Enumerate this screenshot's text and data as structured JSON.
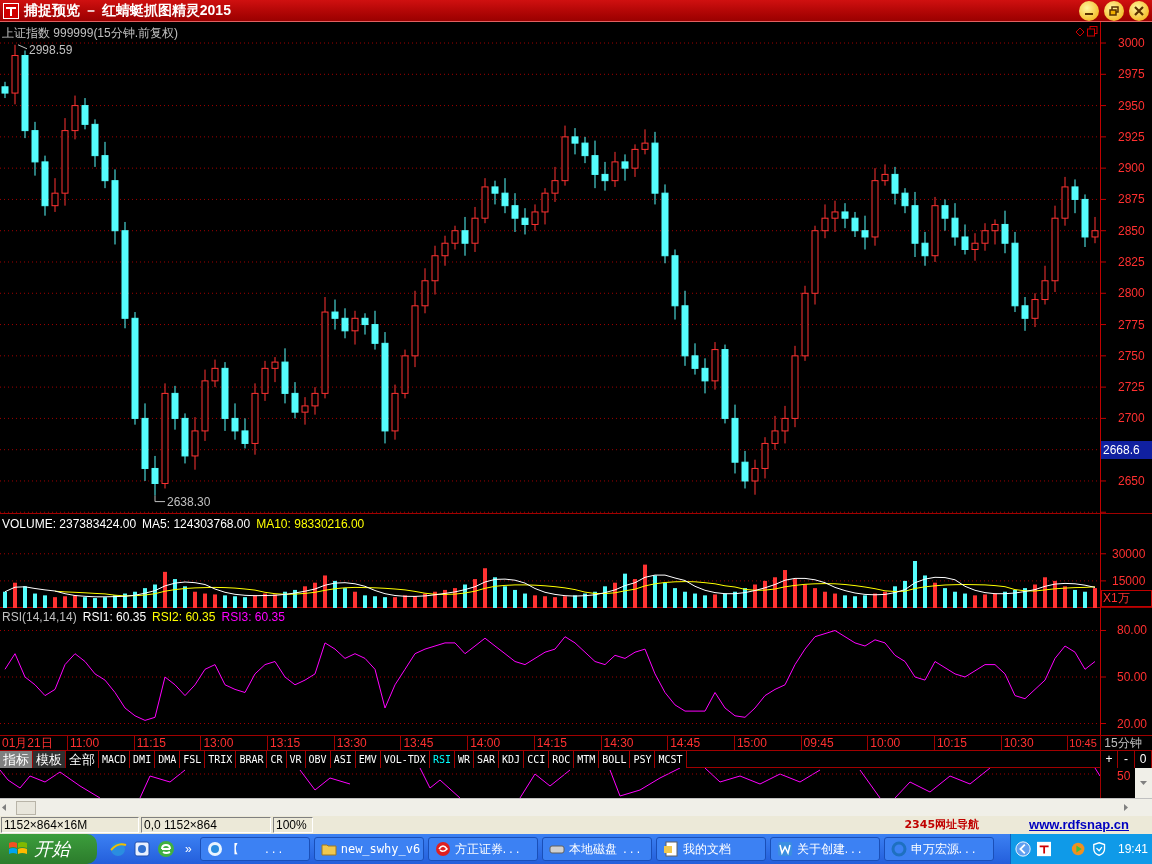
{
  "window": {
    "title": "捕捉预览 － 红蜻蜓抓图精灵2015"
  },
  "price_pane": {
    "title": "上证指数 999999(15分钟.前复权)",
    "high_mark": "2998.59",
    "low_mark": "2638.30",
    "current_price": "2668.6",
    "chart_data": {
      "type": "candlestick",
      "ylim": [
        2623.6,
        3016.8
      ],
      "grid": true,
      "yticks": [
        2650,
        2700,
        2725,
        2750,
        2775,
        2800,
        2825,
        2850,
        2875,
        2900,
        2925,
        2950,
        2975,
        3000
      ],
      "ohlc": [
        [
          2965,
          2969,
          2956,
          2960
        ],
        [
          2960,
          2998.59,
          2951,
          2990
        ],
        [
          2990,
          2994,
          2924,
          2930
        ],
        [
          2930,
          2937,
          2894,
          2905
        ],
        [
          2905,
          2910,
          2862,
          2870
        ],
        [
          2870,
          2892,
          2865,
          2880
        ],
        [
          2880,
          2940,
          2870,
          2930
        ],
        [
          2930,
          2958,
          2923,
          2950
        ],
        [
          2950,
          2956,
          2931,
          2935
        ],
        [
          2935,
          2939,
          2901,
          2910
        ],
        [
          2910,
          2921,
          2884,
          2890
        ],
        [
          2890,
          2899,
          2839,
          2850
        ],
        [
          2850,
          2857,
          2772,
          2780
        ],
        [
          2780,
          2785,
          2695,
          2700
        ],
        [
          2700,
          2712,
          2650,
          2660
        ],
        [
          2660,
          2670,
          2638.3,
          2648
        ],
        [
          2648,
          2728,
          2644,
          2720
        ],
        [
          2720,
          2726,
          2691,
          2700
        ],
        [
          2700,
          2704,
          2664,
          2670
        ],
        [
          2670,
          2701,
          2659,
          2690
        ],
        [
          2690,
          2739,
          2682,
          2730
        ],
        [
          2730,
          2747,
          2725,
          2740
        ],
        [
          2740,
          2745,
          2690,
          2700
        ],
        [
          2700,
          2712,
          2683,
          2690
        ],
        [
          2690,
          2700,
          2676,
          2680
        ],
        [
          2680,
          2728,
          2671,
          2720
        ],
        [
          2720,
          2746,
          2714,
          2740
        ],
        [
          2740,
          2749,
          2729,
          2745
        ],
        [
          2745,
          2756,
          2712,
          2720
        ],
        [
          2720,
          2729,
          2700,
          2705
        ],
        [
          2705,
          2717,
          2695,
          2710
        ],
        [
          2710,
          2725,
          2703,
          2720
        ],
        [
          2720,
          2797,
          2716,
          2785
        ],
        [
          2785,
          2795,
          2771,
          2780
        ],
        [
          2780,
          2788,
          2764,
          2770
        ],
        [
          2770,
          2786,
          2759,
          2780
        ],
        [
          2780,
          2784,
          2767,
          2775
        ],
        [
          2775,
          2786,
          2755,
          2760
        ],
        [
          2760,
          2769,
          2680,
          2690
        ],
        [
          2690,
          2727,
          2683,
          2720
        ],
        [
          2720,
          2755,
          2716,
          2750
        ],
        [
          2750,
          2802,
          2741,
          2790
        ],
        [
          2790,
          2820,
          2784,
          2810
        ],
        [
          2810,
          2838,
          2799,
          2830
        ],
        [
          2830,
          2846,
          2822,
          2840
        ],
        [
          2840,
          2854,
          2835,
          2850
        ],
        [
          2850,
          2861,
          2830,
          2840
        ],
        [
          2840,
          2869,
          2833,
          2860
        ],
        [
          2860,
          2892,
          2856,
          2885
        ],
        [
          2885,
          2890,
          2871,
          2880
        ],
        [
          2880,
          2892,
          2864,
          2870
        ],
        [
          2870,
          2880,
          2849,
          2860
        ],
        [
          2860,
          2868,
          2847,
          2855
        ],
        [
          2855,
          2871,
          2850,
          2865
        ],
        [
          2865,
          2884,
          2855,
          2880
        ],
        [
          2880,
          2901,
          2873,
          2890
        ],
        [
          2890,
          2934,
          2886,
          2925
        ],
        [
          2925,
          2932,
          2911,
          2920
        ],
        [
          2920,
          2925,
          2904,
          2910
        ],
        [
          2910,
          2922,
          2884,
          2895
        ],
        [
          2895,
          2905,
          2882,
          2890
        ],
        [
          2890,
          2913,
          2885,
          2905
        ],
        [
          2905,
          2911,
          2890,
          2900
        ],
        [
          2900,
          2919,
          2893,
          2915
        ],
        [
          2915,
          2931,
          2911,
          2920
        ],
        [
          2920,
          2929,
          2871,
          2880
        ],
        [
          2880,
          2887,
          2824,
          2830
        ],
        [
          2830,
          2835,
          2779,
          2790
        ],
        [
          2790,
          2802,
          2742,
          2750
        ],
        [
          2750,
          2760,
          2735,
          2740
        ],
        [
          2740,
          2748,
          2720,
          2730
        ],
        [
          2730,
          2761,
          2723,
          2755
        ],
        [
          2755,
          2759,
          2696,
          2700
        ],
        [
          2700,
          2711,
          2656,
          2665
        ],
        [
          2665,
          2674,
          2644,
          2650
        ],
        [
          2650,
          2667,
          2639,
          2660
        ],
        [
          2660,
          2685,
          2652,
          2680
        ],
        [
          2680,
          2702,
          2675,
          2690
        ],
        [
          2690,
          2710,
          2680,
          2700
        ],
        [
          2700,
          2758,
          2693,
          2750
        ],
        [
          2750,
          2806,
          2746,
          2800
        ],
        [
          2800,
          2854,
          2791,
          2850
        ],
        [
          2850,
          2871,
          2844,
          2860
        ],
        [
          2860,
          2874,
          2849,
          2865
        ],
        [
          2865,
          2872,
          2852,
          2860
        ],
        [
          2860,
          2865,
          2845,
          2850
        ],
        [
          2850,
          2862,
          2835,
          2845
        ],
        [
          2845,
          2900,
          2838,
          2890
        ],
        [
          2890,
          2903,
          2886,
          2895
        ],
        [
          2895,
          2901,
          2871,
          2880
        ],
        [
          2880,
          2884,
          2864,
          2870
        ],
        [
          2870,
          2881,
          2829,
          2840
        ],
        [
          2840,
          2849,
          2822,
          2830
        ],
        [
          2830,
          2877,
          2825,
          2870
        ],
        [
          2870,
          2875,
          2850,
          2860
        ],
        [
          2860,
          2872,
          2838,
          2845
        ],
        [
          2845,
          2855,
          2831,
          2835
        ],
        [
          2835,
          2848,
          2826,
          2840
        ],
        [
          2840,
          2856,
          2834,
          2850
        ],
        [
          2850,
          2859,
          2839,
          2855
        ],
        [
          2855,
          2866,
          2832,
          2840
        ],
        [
          2840,
          2849,
          2785,
          2790
        ],
        [
          2790,
          2797,
          2770,
          2780
        ],
        [
          2780,
          2800,
          2773,
          2795
        ],
        [
          2795,
          2822,
          2791,
          2810
        ],
        [
          2810,
          2870,
          2801,
          2860
        ],
        [
          2860,
          2893,
          2854,
          2885
        ],
        [
          2885,
          2891,
          2864,
          2875
        ],
        [
          2875,
          2879,
          2837,
          2845
        ],
        [
          2845,
          2861,
          2840,
          2850
        ]
      ]
    }
  },
  "volume_pane": {
    "volume": "VOLUME: 237383424.00",
    "ma5": "MA5: 124303768.00",
    "ma10": "MA10: 98330216.00",
    "unit": "X1万",
    "chart_data": {
      "type": "bar",
      "ylim": [
        0,
        52000
      ],
      "yticks": [
        15000,
        30000
      ],
      "grid": true,
      "colors": [
        "#54fcfc",
        "#ff3232",
        "#54fcfc",
        "#54fcfc",
        "#54fcfc",
        "#ff3232",
        "#ff3232",
        "#ff3232",
        "#54fcfc",
        "#54fcfc",
        "#54fcfc",
        "#54fcfc",
        "#54fcfc",
        "#54fcfc",
        "#54fcfc",
        "#54fcfc",
        "#ff3232",
        "#54fcfc",
        "#54fcfc",
        "#ff3232",
        "#ff3232",
        "#ff3232",
        "#54fcfc",
        "#54fcfc",
        "#54fcfc",
        "#ff3232",
        "#ff3232",
        "#ff3232",
        "#54fcfc",
        "#54fcfc",
        "#ff3232",
        "#ff3232",
        "#ff3232",
        "#54fcfc",
        "#54fcfc",
        "#ff3232",
        "#54fcfc",
        "#54fcfc",
        "#54fcfc",
        "#ff3232",
        "#ff3232",
        "#ff3232",
        "#ff3232",
        "#ff3232",
        "#ff3232",
        "#ff3232",
        "#54fcfc",
        "#ff3232",
        "#ff3232",
        "#54fcfc",
        "#54fcfc",
        "#54fcfc",
        "#54fcfc",
        "#ff3232",
        "#ff3232",
        "#ff3232",
        "#ff3232",
        "#54fcfc",
        "#54fcfc",
        "#54fcfc",
        "#54fcfc",
        "#ff3232",
        "#54fcfc",
        "#ff3232",
        "#ff3232",
        "#54fcfc",
        "#54fcfc",
        "#54fcfc",
        "#54fcfc",
        "#54fcfc",
        "#54fcfc",
        "#ff3232",
        "#54fcfc",
        "#54fcfc",
        "#54fcfc",
        "#ff3232",
        "#ff3232",
        "#ff3232",
        "#ff3232",
        "#ff3232",
        "#ff3232",
        "#ff3232",
        "#ff3232",
        "#ff3232",
        "#54fcfc",
        "#54fcfc",
        "#54fcfc",
        "#ff3232",
        "#ff3232",
        "#54fcfc",
        "#54fcfc",
        "#54fcfc",
        "#54fcfc",
        "#ff3232",
        "#54fcfc",
        "#54fcfc",
        "#54fcfc",
        "#ff3232",
        "#ff3232",
        "#ff3232",
        "#54fcfc",
        "#54fcfc",
        "#54fcfc",
        "#ff3232",
        "#ff3232",
        "#ff3232",
        "#ff3232",
        "#54fcfc",
        "#54fcfc",
        "#ff3232"
      ],
      "values": [
        9000,
        14000,
        12000,
        8000,
        7000,
        6000,
        6500,
        7000,
        6000,
        5500,
        6000,
        7000,
        8000,
        9000,
        11000,
        13000,
        20000,
        16000,
        12000,
        9000,
        8000,
        7500,
        7000,
        6500,
        6000,
        7000,
        8000,
        7500,
        9000,
        10000,
        12000,
        14000,
        18000,
        15000,
        11000,
        9000,
        7000,
        6500,
        6000,
        6000,
        7000,
        6500,
        8000,
        9000,
        10000,
        11000,
        13000,
        16000,
        22000,
        17000,
        12000,
        10000,
        8000,
        7000,
        6500,
        6000,
        6500,
        7000,
        8000,
        9000,
        12000,
        14000,
        19000,
        16000,
        24000,
        18000,
        14000,
        11000,
        9000,
        8000,
        7000,
        7500,
        8000,
        9000,
        11000,
        13000,
        15000,
        17000,
        21000,
        16000,
        13000,
        11000,
        9000,
        8000,
        7000,
        6500,
        7000,
        8000,
        9000,
        12000,
        15000,
        26000,
        18000,
        14000,
        11000,
        9000,
        8000,
        7000,
        7500,
        8000,
        9000,
        10000,
        11000,
        13000,
        17000,
        15000,
        12000,
        10000,
        9000,
        11000
      ],
      "series": [
        {
          "type": "line",
          "color": "#ffffff",
          "values": [
            9000,
            11500,
            11700,
            10800,
            10000,
            9400,
            7900,
            6900,
            6500,
            6200,
            6200,
            6300,
            6500,
            7100,
            8200,
            9600,
            12200,
            13800,
            14400,
            14000,
            13000,
            10500,
            8700,
            7600,
            7000,
            6800,
            6900,
            7000,
            7500,
            8300,
            9300,
            10500,
            12600,
            13800,
            14000,
            13400,
            12000,
            9700,
            7900,
            6900,
            6500,
            6400,
            6700,
            7300,
            8100,
            8900,
            10200,
            11800,
            14400,
            15800,
            16000,
            15400,
            13800,
            10800,
            8700,
            7500,
            6800,
            6600,
            6800,
            7300,
            8500,
            10000,
            12400,
            14000,
            17000,
            18200,
            18200,
            16600,
            15200,
            12000,
            9800,
            8500,
            7900,
            7900,
            8500,
            9700,
            11200,
            13000,
            15400,
            16400,
            16400,
            15600,
            14000,
            11400,
            9600,
            8300,
            7500,
            7300,
            7500,
            8500,
            10200,
            14000,
            16000,
            17000,
            16800,
            15600,
            12000,
            9800,
            8500,
            7900,
            7900,
            8300,
            9100,
            10200,
            12000,
            13200,
            13600,
            13400,
            12600,
            11400
          ]
        },
        {
          "type": "line",
          "color": "#ffff00",
          "values": [
            null,
            null,
            null,
            null,
            null,
            9300,
            8900,
            8700,
            8400,
            8100,
            7800,
            7100,
            6700,
            6800,
            7200,
            7900,
            9300,
            10200,
            10800,
            11100,
            11300,
            11400,
            11300,
            11000,
            10500,
            9900,
            8700,
            7900,
            7600,
            7700,
            8100,
            8700,
            9800,
            10700,
            11200,
            11400,
            11300,
            11200,
            10900,
            10500,
            10000,
            9200,
            8200,
            7600,
            7500,
            7700,
            8300,
            9300,
            10900,
            12000,
            12500,
            12800,
            12800,
            12600,
            12300,
            11800,
            11100,
            10200,
            8800,
            8000,
            8000,
            8400,
            9500,
            10400,
            12200,
            13400,
            14100,
            14500,
            14600,
            14500,
            14000,
            13400,
            12300,
            11600,
            10300,
            9800,
            9900,
            10500,
            11700,
            12500,
            13100,
            13400,
            13500,
            13400,
            13000,
            12400,
            11600,
            10700,
            9500,
            9100,
            9300,
            10800,
            11700,
            12300,
            12700,
            12900,
            13000,
            12900,
            12800,
            12400,
            11800,
            10200,
            9500,
            9400,
            10000,
            10600,
            11000,
            11300,
            11400,
            11700
          ]
        }
      ]
    }
  },
  "rsi_pane": {
    "label": "RSI(14,14,14)",
    "rsi1": "RSI1: 60.35",
    "rsi2": "RSI2: 60.35",
    "rsi3": "RSI3: 60.35",
    "chart_data": {
      "type": "line",
      "ylim": [
        12.6,
        94.5
      ],
      "grid": true,
      "yticks": [
        {
          "value": 20,
          "label": "20.00"
        },
        {
          "value": 50,
          "label": "50.00"
        },
        {
          "value": 80,
          "label": "80.00"
        }
      ],
      "series": [
        {
          "color": "#ff00ff",
          "values": [
            55,
            65,
            50,
            45,
            38,
            42,
            58,
            65,
            60,
            52,
            48,
            40,
            30,
            25,
            22,
            24,
            50,
            45,
            38,
            45,
            55,
            58,
            45,
            42,
            40,
            52,
            58,
            60,
            50,
            45,
            48,
            52,
            72,
            68,
            62,
            65,
            62,
            55,
            30,
            45,
            55,
            65,
            68,
            70,
            72,
            72,
            65,
            70,
            75,
            70,
            65,
            60,
            58,
            62,
            66,
            68,
            76,
            72,
            66,
            60,
            58,
            64,
            62,
            66,
            68,
            52,
            40,
            32,
            28,
            28,
            28,
            40,
            30,
            25,
            24,
            30,
            38,
            42,
            45,
            58,
            68,
            76,
            78,
            80,
            76,
            72,
            70,
            74,
            72,
            64,
            60,
            50,
            48,
            60,
            56,
            52,
            50,
            54,
            58,
            58,
            52,
            38,
            36,
            42,
            48,
            62,
            70,
            66,
            55,
            60
          ]
        }
      ]
    }
  },
  "time_axis": {
    "labels": [
      "01月21日",
      "11:00",
      "11:15",
      "13:00",
      "13:15",
      "13:30",
      "13:45",
      "14:00",
      "14:15",
      "14:30",
      "14:45",
      "15:00",
      "09:45",
      "10:00",
      "10:15",
      "10:30",
      "10:45"
    ],
    "period": "15分钟"
  },
  "tabs": [
    {
      "label": "指标",
      "kind": "mode",
      "selected": true
    },
    {
      "label": "模板",
      "kind": "mode",
      "selected": false
    },
    {
      "label": "全部",
      "kind": "mode",
      "selected": false
    },
    {
      "label": "MACD",
      "kind": "indicator",
      "selected": false
    },
    {
      "label": "DMI",
      "kind": "indicator",
      "selected": false
    },
    {
      "label": "DMA",
      "kind": "indicator",
      "selected": false
    },
    {
      "label": "FSL",
      "kind": "indicator",
      "selected": false
    },
    {
      "label": "TRIX",
      "kind": "indicator",
      "selected": false
    },
    {
      "label": "BRAR",
      "kind": "indicator",
      "selected": false
    },
    {
      "label": "CR",
      "kind": "indicator",
      "selected": false
    },
    {
      "label": "VR",
      "kind": "indicator",
      "selected": false
    },
    {
      "label": "OBV",
      "kind": "indicator",
      "selected": false
    },
    {
      "label": "ASI",
      "kind": "indicator",
      "selected": false
    },
    {
      "label": "EMV",
      "kind": "indicator",
      "selected": false
    },
    {
      "label": "VOL-TDX",
      "kind": "indicator",
      "selected": false
    },
    {
      "label": "RSI",
      "kind": "indicator",
      "selected": true
    },
    {
      "label": "WR",
      "kind": "indicator",
      "selected": false
    },
    {
      "label": "SAR",
      "kind": "indicator",
      "selected": false
    },
    {
      "label": "KDJ",
      "kind": "indicator",
      "selected": false
    },
    {
      "label": "CCI",
      "kind": "indicator",
      "selected": false
    },
    {
      "label": "ROC",
      "kind": "indicator",
      "selected": false
    },
    {
      "label": "MTM",
      "kind": "indicator",
      "selected": false
    },
    {
      "label": "BOLL",
      "kind": "indicator",
      "selected": false
    },
    {
      "label": "PSY",
      "kind": "indicator",
      "selected": false
    },
    {
      "label": "MCST",
      "kind": "indicator",
      "selected": false
    }
  ],
  "zoom_buttons": [
    "+",
    "-",
    "0"
  ],
  "lower_pane": {
    "axis_label": "50"
  },
  "status_bar": {
    "cells": [
      "1152×864×16M",
      "0,0 1152×864",
      "100%"
    ],
    "ad_link": "2345网址导航",
    "site_link": "www.rdfsnap.cn"
  },
  "taskbar": {
    "start": "开始",
    "overflow": "»",
    "tasks": [
      {
        "label": "【        . . ."
      },
      {
        "label": "new_swhy_v6"
      },
      {
        "label": "方正证券. . ."
      },
      {
        "label": "本地磁盘  . . ."
      },
      {
        "label": "我的文档"
      },
      {
        "label": "关于创建. . ."
      },
      {
        "label": "申万宏源. . ."
      }
    ],
    "clock": "19:41"
  }
}
